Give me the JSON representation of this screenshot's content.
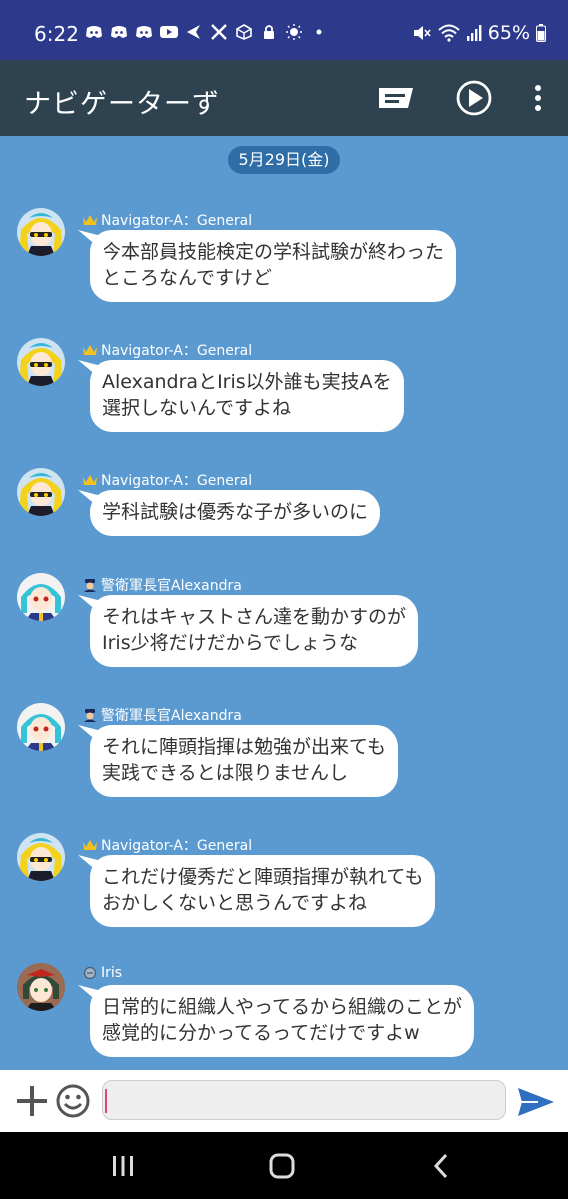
{
  "status": {
    "time": "6:22",
    "battery": "65%"
  },
  "app": {
    "title": "ナビゲーターず"
  },
  "chat": {
    "date": "5月29日(金)",
    "messages": [
      {
        "sender": "Navigator-A：General",
        "text": "今本部員技能検定の学科試験が終わった\nところなんですけど"
      },
      {
        "sender": "Navigator-A：General",
        "text": "AlexandraとIris以外誰も実技Aを\n選択しないんですよね"
      },
      {
        "sender": "Navigator-A：General",
        "text": "学科試験は優秀な子が多いのに"
      },
      {
        "sender": "警衛軍長官Alexandra",
        "text": "それはキャストさん達を動かすのが\nIris少将だけだからでしょうな"
      },
      {
        "sender": "警衛軍長官Alexandra",
        "text": "それに陣頭指揮は勉強が出来ても\n実践できるとは限りませんし"
      },
      {
        "sender": "Navigator-A：General",
        "text": "これだけ優秀だと陣頭指揮が執れても\nおかしくないと思うんですよね"
      },
      {
        "sender": "Iris",
        "text": "日常的に組織人やってるから組織のことが\n感覚的に分かってるってだけですよw"
      }
    ]
  },
  "input": {
    "placeholder": ""
  },
  "colors": {
    "status_bar": "#2d3a8c",
    "app_bar": "#2e4250",
    "chat_bg": "#5b9ad0",
    "date_pill": "#2e6da6",
    "send": "#2f6fc0"
  }
}
